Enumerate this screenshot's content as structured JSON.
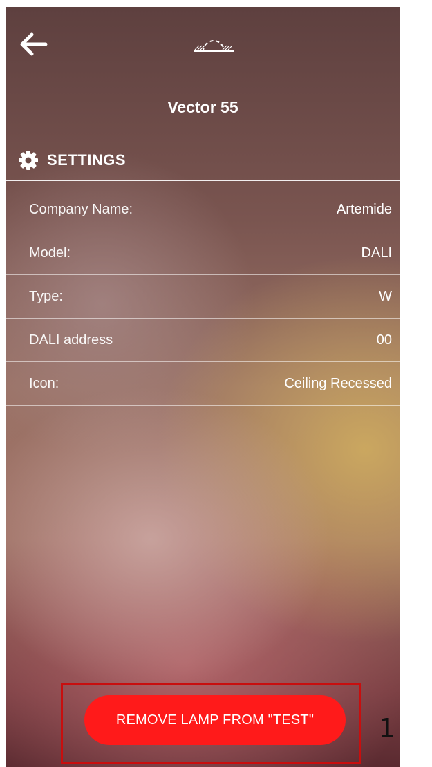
{
  "header": {
    "back_icon": "arrow-left-icon",
    "lamp_icon": "ceiling-recessed-lamp-icon",
    "title": "Vector 55"
  },
  "settings": {
    "icon": "gear-icon",
    "heading": "SETTINGS",
    "rows": [
      {
        "label": "Company Name:",
        "value": "Artemide"
      },
      {
        "label": "Model:",
        "value": "DALI"
      },
      {
        "label": "Type:",
        "value": "W"
      },
      {
        "label": "DALI address",
        "value": "00"
      },
      {
        "label": "Icon:",
        "value": "Ceiling Recessed"
      }
    ]
  },
  "actions": {
    "remove_label": "REMOVE LAMP FROM \"TEST\""
  },
  "annotation": {
    "number": "1",
    "box_color": "#c80e0e"
  },
  "colors": {
    "button": "#ff1a1a",
    "text": "#ffffff"
  }
}
